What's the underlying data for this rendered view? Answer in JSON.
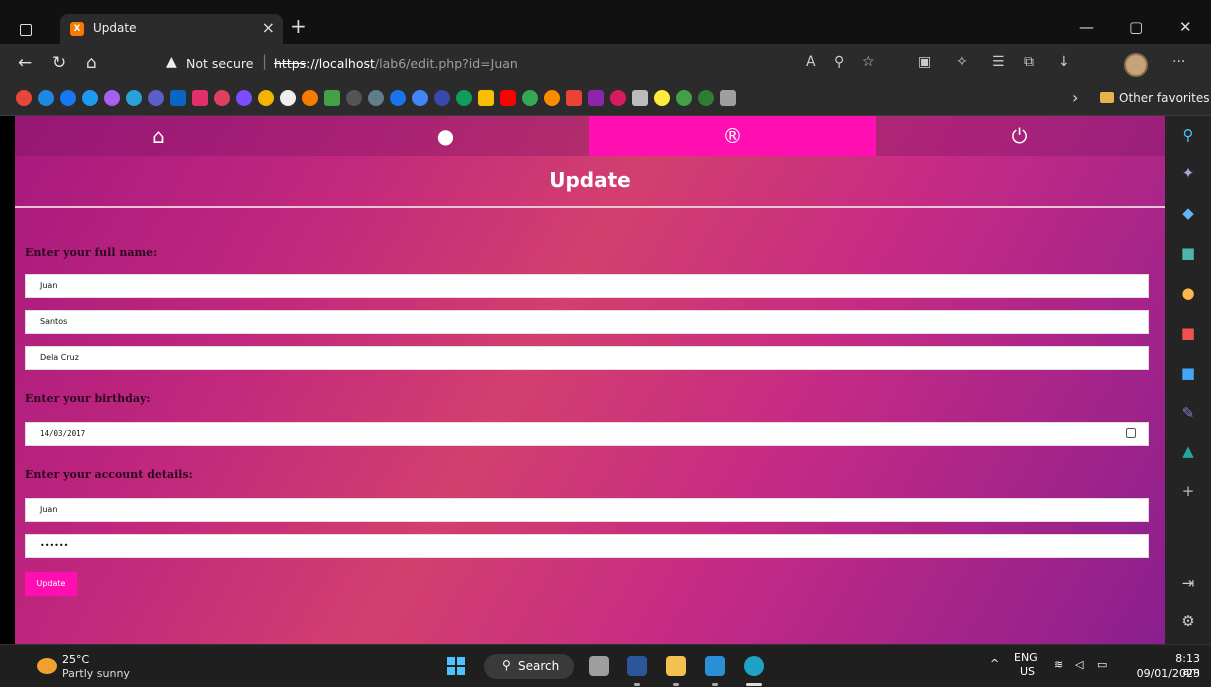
{
  "browser": {
    "tab_title": "Update",
    "tab_close": "×",
    "new_tab": "+",
    "security_label": "Not secure",
    "url_scheme": "https",
    "url_host": "://localhost",
    "url_path": "/lab6/edit.php?id=Juan",
    "other_favorites": "Other favorites"
  },
  "nav": {
    "items": [
      {
        "icon": "home-icon",
        "glyph": "⌂"
      },
      {
        "icon": "user-icon",
        "glyph": "●"
      },
      {
        "icon": "registered-icon",
        "glyph": "®"
      },
      {
        "icon": "power-icon",
        "glyph": "⏻"
      }
    ],
    "active_index": 2
  },
  "page": {
    "title": "Update",
    "fullname_label": "Enter your full name:",
    "first_name": "Juan",
    "middle_name": "Santos",
    "last_name": "Dela Cruz",
    "birthday_label": "Enter your birthday:",
    "birthday": "14/03/2017",
    "account_label": "Enter your account details:",
    "username": "Juan",
    "password": "••••••",
    "submit_label": "Update"
  },
  "taskbar": {
    "temperature": "25°C",
    "weather": "Partly sunny",
    "search_label": "Search",
    "lang_top": "ENG",
    "lang_bottom": "US",
    "time": "8:13 am",
    "date": "09/01/2023"
  },
  "colors": {
    "accent": "#ff0fb1",
    "gradient_start": "#a7197f",
    "gradient_end": "#8a1f8e"
  }
}
